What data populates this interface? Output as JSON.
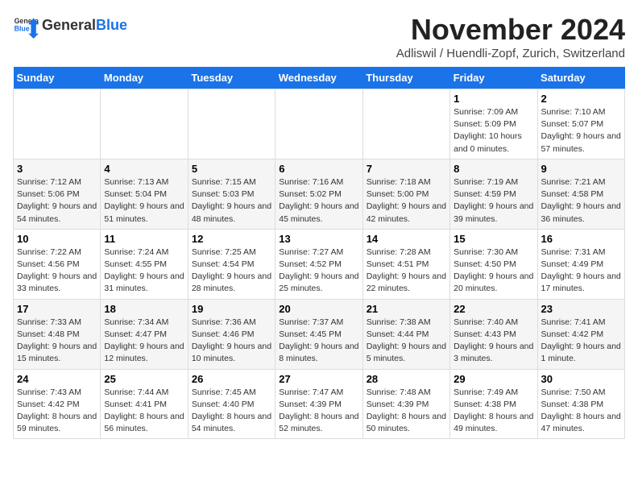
{
  "header": {
    "logo_general": "General",
    "logo_blue": "Blue",
    "month_title": "November 2024",
    "subtitle": "Adliswil / Huendli-Zopf, Zurich, Switzerland"
  },
  "weekdays": [
    "Sunday",
    "Monday",
    "Tuesday",
    "Wednesday",
    "Thursday",
    "Friday",
    "Saturday"
  ],
  "weeks": [
    [
      {
        "day": "",
        "info": ""
      },
      {
        "day": "",
        "info": ""
      },
      {
        "day": "",
        "info": ""
      },
      {
        "day": "",
        "info": ""
      },
      {
        "day": "",
        "info": ""
      },
      {
        "day": "1",
        "info": "Sunrise: 7:09 AM\nSunset: 5:09 PM\nDaylight: 10 hours and 0 minutes."
      },
      {
        "day": "2",
        "info": "Sunrise: 7:10 AM\nSunset: 5:07 PM\nDaylight: 9 hours and 57 minutes."
      }
    ],
    [
      {
        "day": "3",
        "info": "Sunrise: 7:12 AM\nSunset: 5:06 PM\nDaylight: 9 hours and 54 minutes."
      },
      {
        "day": "4",
        "info": "Sunrise: 7:13 AM\nSunset: 5:04 PM\nDaylight: 9 hours and 51 minutes."
      },
      {
        "day": "5",
        "info": "Sunrise: 7:15 AM\nSunset: 5:03 PM\nDaylight: 9 hours and 48 minutes."
      },
      {
        "day": "6",
        "info": "Sunrise: 7:16 AM\nSunset: 5:02 PM\nDaylight: 9 hours and 45 minutes."
      },
      {
        "day": "7",
        "info": "Sunrise: 7:18 AM\nSunset: 5:00 PM\nDaylight: 9 hours and 42 minutes."
      },
      {
        "day": "8",
        "info": "Sunrise: 7:19 AM\nSunset: 4:59 PM\nDaylight: 9 hours and 39 minutes."
      },
      {
        "day": "9",
        "info": "Sunrise: 7:21 AM\nSunset: 4:58 PM\nDaylight: 9 hours and 36 minutes."
      }
    ],
    [
      {
        "day": "10",
        "info": "Sunrise: 7:22 AM\nSunset: 4:56 PM\nDaylight: 9 hours and 33 minutes."
      },
      {
        "day": "11",
        "info": "Sunrise: 7:24 AM\nSunset: 4:55 PM\nDaylight: 9 hours and 31 minutes."
      },
      {
        "day": "12",
        "info": "Sunrise: 7:25 AM\nSunset: 4:54 PM\nDaylight: 9 hours and 28 minutes."
      },
      {
        "day": "13",
        "info": "Sunrise: 7:27 AM\nSunset: 4:52 PM\nDaylight: 9 hours and 25 minutes."
      },
      {
        "day": "14",
        "info": "Sunrise: 7:28 AM\nSunset: 4:51 PM\nDaylight: 9 hours and 22 minutes."
      },
      {
        "day": "15",
        "info": "Sunrise: 7:30 AM\nSunset: 4:50 PM\nDaylight: 9 hours and 20 minutes."
      },
      {
        "day": "16",
        "info": "Sunrise: 7:31 AM\nSunset: 4:49 PM\nDaylight: 9 hours and 17 minutes."
      }
    ],
    [
      {
        "day": "17",
        "info": "Sunrise: 7:33 AM\nSunset: 4:48 PM\nDaylight: 9 hours and 15 minutes."
      },
      {
        "day": "18",
        "info": "Sunrise: 7:34 AM\nSunset: 4:47 PM\nDaylight: 9 hours and 12 minutes."
      },
      {
        "day": "19",
        "info": "Sunrise: 7:36 AM\nSunset: 4:46 PM\nDaylight: 9 hours and 10 minutes."
      },
      {
        "day": "20",
        "info": "Sunrise: 7:37 AM\nSunset: 4:45 PM\nDaylight: 9 hours and 8 minutes."
      },
      {
        "day": "21",
        "info": "Sunrise: 7:38 AM\nSunset: 4:44 PM\nDaylight: 9 hours and 5 minutes."
      },
      {
        "day": "22",
        "info": "Sunrise: 7:40 AM\nSunset: 4:43 PM\nDaylight: 9 hours and 3 minutes."
      },
      {
        "day": "23",
        "info": "Sunrise: 7:41 AM\nSunset: 4:42 PM\nDaylight: 9 hours and 1 minute."
      }
    ],
    [
      {
        "day": "24",
        "info": "Sunrise: 7:43 AM\nSunset: 4:42 PM\nDaylight: 8 hours and 59 minutes."
      },
      {
        "day": "25",
        "info": "Sunrise: 7:44 AM\nSunset: 4:41 PM\nDaylight: 8 hours and 56 minutes."
      },
      {
        "day": "26",
        "info": "Sunrise: 7:45 AM\nSunset: 4:40 PM\nDaylight: 8 hours and 54 minutes."
      },
      {
        "day": "27",
        "info": "Sunrise: 7:47 AM\nSunset: 4:39 PM\nDaylight: 8 hours and 52 minutes."
      },
      {
        "day": "28",
        "info": "Sunrise: 7:48 AM\nSunset: 4:39 PM\nDaylight: 8 hours and 50 minutes."
      },
      {
        "day": "29",
        "info": "Sunrise: 7:49 AM\nSunset: 4:38 PM\nDaylight: 8 hours and 49 minutes."
      },
      {
        "day": "30",
        "info": "Sunrise: 7:50 AM\nSunset: 4:38 PM\nDaylight: 8 hours and 47 minutes."
      }
    ]
  ]
}
